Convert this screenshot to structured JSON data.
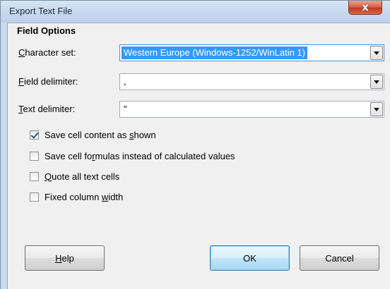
{
  "window": {
    "title": "Export Text File",
    "close_glyph": "x"
  },
  "field_options": {
    "heading": "Field Options",
    "character_set": {
      "label_mnemonic": "C",
      "label_rest": "haracter set:",
      "value": "Western Europe (Windows-1252/WinLatin 1)"
    },
    "field_delimiter": {
      "label_mnemonic": "F",
      "label_rest": "ield delimiter:",
      "value": ","
    },
    "text_delimiter": {
      "label_mnemonic": "T",
      "label_rest": "ext delimiter:",
      "value": "\""
    }
  },
  "checkboxes": [
    {
      "before": "Save cell content as ",
      "mnemonic": "s",
      "after": "hown",
      "checked": true
    },
    {
      "before": "Save cell fo",
      "mnemonic": "r",
      "after": "mulas instead of calculated values",
      "checked": false
    },
    {
      "before": "",
      "mnemonic": "Q",
      "after": "uote all text cells",
      "checked": false
    },
    {
      "before": "Fixed column ",
      "mnemonic": "w",
      "after": "idth",
      "checked": false
    }
  ],
  "buttons": {
    "help_mnemonic": "H",
    "help_rest": "elp",
    "ok": "OK",
    "cancel": "Cancel"
  },
  "colors": {
    "selection": "#3399ff",
    "close_button": "#c2391e",
    "title_bar": "#c6d8ee"
  },
  "icons": {
    "close": "close-icon",
    "dropdown": "chevron-down-icon",
    "check": "checkmark-icon"
  }
}
